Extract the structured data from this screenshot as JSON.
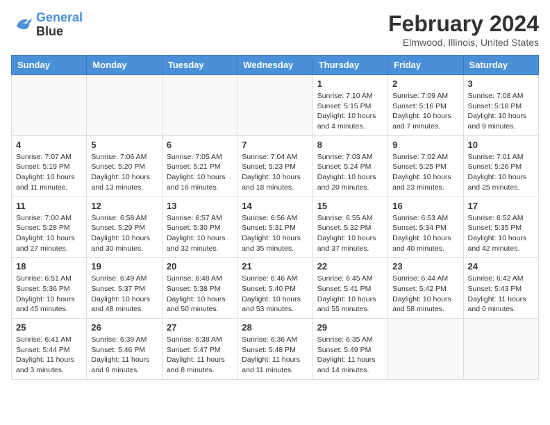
{
  "header": {
    "logo_line1": "General",
    "logo_line2": "Blue",
    "title": "February 2024",
    "subtitle": "Elmwood, Illinois, United States"
  },
  "weekdays": [
    "Sunday",
    "Monday",
    "Tuesday",
    "Wednesday",
    "Thursday",
    "Friday",
    "Saturday"
  ],
  "weeks": [
    [
      {
        "day": "",
        "info": ""
      },
      {
        "day": "",
        "info": ""
      },
      {
        "day": "",
        "info": ""
      },
      {
        "day": "",
        "info": ""
      },
      {
        "day": "1",
        "info": "Sunrise: 7:10 AM\nSunset: 5:15 PM\nDaylight: 10 hours\nand 4 minutes."
      },
      {
        "day": "2",
        "info": "Sunrise: 7:09 AM\nSunset: 5:16 PM\nDaylight: 10 hours\nand 7 minutes."
      },
      {
        "day": "3",
        "info": "Sunrise: 7:08 AM\nSunset: 5:18 PM\nDaylight: 10 hours\nand 9 minutes."
      }
    ],
    [
      {
        "day": "4",
        "info": "Sunrise: 7:07 AM\nSunset: 5:19 PM\nDaylight: 10 hours\nand 11 minutes."
      },
      {
        "day": "5",
        "info": "Sunrise: 7:06 AM\nSunset: 5:20 PM\nDaylight: 10 hours\nand 13 minutes."
      },
      {
        "day": "6",
        "info": "Sunrise: 7:05 AM\nSunset: 5:21 PM\nDaylight: 10 hours\nand 16 minutes."
      },
      {
        "day": "7",
        "info": "Sunrise: 7:04 AM\nSunset: 5:23 PM\nDaylight: 10 hours\nand 18 minutes."
      },
      {
        "day": "8",
        "info": "Sunrise: 7:03 AM\nSunset: 5:24 PM\nDaylight: 10 hours\nand 20 minutes."
      },
      {
        "day": "9",
        "info": "Sunrise: 7:02 AM\nSunset: 5:25 PM\nDaylight: 10 hours\nand 23 minutes."
      },
      {
        "day": "10",
        "info": "Sunrise: 7:01 AM\nSunset: 5:26 PM\nDaylight: 10 hours\nand 25 minutes."
      }
    ],
    [
      {
        "day": "11",
        "info": "Sunrise: 7:00 AM\nSunset: 5:28 PM\nDaylight: 10 hours\nand 27 minutes."
      },
      {
        "day": "12",
        "info": "Sunrise: 6:58 AM\nSunset: 5:29 PM\nDaylight: 10 hours\nand 30 minutes."
      },
      {
        "day": "13",
        "info": "Sunrise: 6:57 AM\nSunset: 5:30 PM\nDaylight: 10 hours\nand 32 minutes."
      },
      {
        "day": "14",
        "info": "Sunrise: 6:56 AM\nSunset: 5:31 PM\nDaylight: 10 hours\nand 35 minutes."
      },
      {
        "day": "15",
        "info": "Sunrise: 6:55 AM\nSunset: 5:32 PM\nDaylight: 10 hours\nand 37 minutes."
      },
      {
        "day": "16",
        "info": "Sunrise: 6:53 AM\nSunset: 5:34 PM\nDaylight: 10 hours\nand 40 minutes."
      },
      {
        "day": "17",
        "info": "Sunrise: 6:52 AM\nSunset: 5:35 PM\nDaylight: 10 hours\nand 42 minutes."
      }
    ],
    [
      {
        "day": "18",
        "info": "Sunrise: 6:51 AM\nSunset: 5:36 PM\nDaylight: 10 hours\nand 45 minutes."
      },
      {
        "day": "19",
        "info": "Sunrise: 6:49 AM\nSunset: 5:37 PM\nDaylight: 10 hours\nand 48 minutes."
      },
      {
        "day": "20",
        "info": "Sunrise: 6:48 AM\nSunset: 5:38 PM\nDaylight: 10 hours\nand 50 minutes."
      },
      {
        "day": "21",
        "info": "Sunrise: 6:46 AM\nSunset: 5:40 PM\nDaylight: 10 hours\nand 53 minutes."
      },
      {
        "day": "22",
        "info": "Sunrise: 6:45 AM\nSunset: 5:41 PM\nDaylight: 10 hours\nand 55 minutes."
      },
      {
        "day": "23",
        "info": "Sunrise: 6:44 AM\nSunset: 5:42 PM\nDaylight: 10 hours\nand 58 minutes."
      },
      {
        "day": "24",
        "info": "Sunrise: 6:42 AM\nSunset: 5:43 PM\nDaylight: 11 hours\nand 0 minutes."
      }
    ],
    [
      {
        "day": "25",
        "info": "Sunrise: 6:41 AM\nSunset: 5:44 PM\nDaylight: 11 hours\nand 3 minutes."
      },
      {
        "day": "26",
        "info": "Sunrise: 6:39 AM\nSunset: 5:46 PM\nDaylight: 11 hours\nand 6 minutes."
      },
      {
        "day": "27",
        "info": "Sunrise: 6:38 AM\nSunset: 5:47 PM\nDaylight: 11 hours\nand 8 minutes."
      },
      {
        "day": "28",
        "info": "Sunrise: 6:36 AM\nSunset: 5:48 PM\nDaylight: 11 hours\nand 11 minutes."
      },
      {
        "day": "29",
        "info": "Sunrise: 6:35 AM\nSunset: 5:49 PM\nDaylight: 11 hours\nand 14 minutes."
      },
      {
        "day": "",
        "info": ""
      },
      {
        "day": "",
        "info": ""
      }
    ]
  ]
}
